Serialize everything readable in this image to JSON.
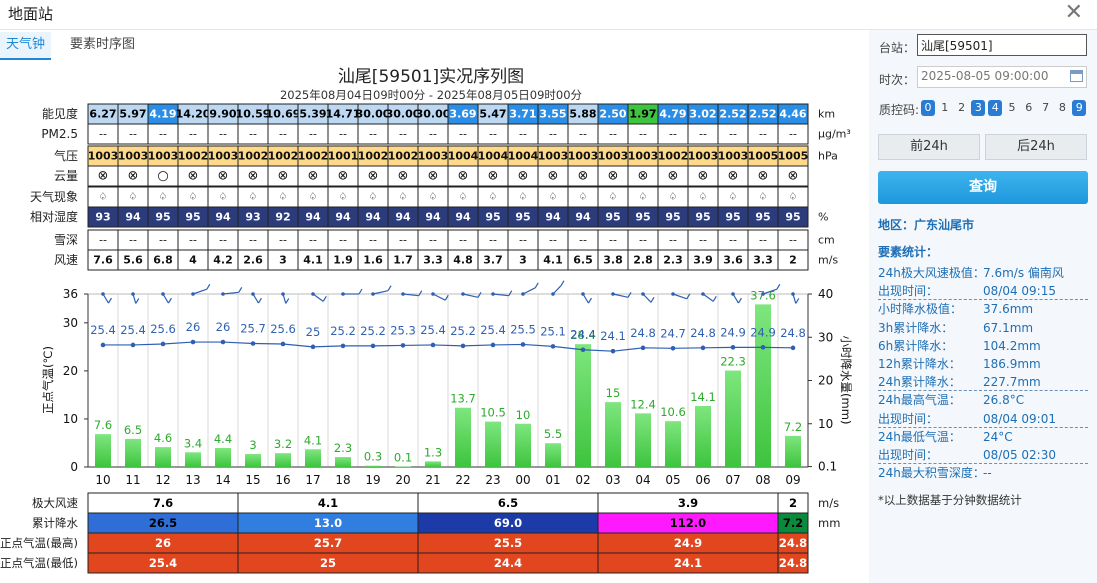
{
  "window": {
    "title": "地面站",
    "close_icon": "close-icon"
  },
  "tabs": [
    {
      "label": "天气钟",
      "active": true
    },
    {
      "label": "要素时序图",
      "active": false
    }
  ],
  "chart_header": {
    "title": "汕尾[59501]实况序列图",
    "subtitle": "2025年08月04日09时00分 - 2025年08月05日09时00分"
  },
  "hours": [
    "10",
    "11",
    "12",
    "13",
    "14",
    "15",
    "16",
    "17",
    "18",
    "19",
    "20",
    "21",
    "22",
    "23",
    "00",
    "01",
    "02",
    "03",
    "04",
    "05",
    "06",
    "07",
    "08",
    "09"
  ],
  "clock_rows": [
    {
      "label": "能见度",
      "unit": "km",
      "kind": "vis",
      "values": [
        "6.27",
        "5.97",
        "4.19",
        "14.20",
        "9.90",
        "10.59",
        "10.69",
        "5.39",
        "14.71",
        "30.00",
        "30.00",
        "30.00",
        "3.69",
        "5.47",
        "3.71",
        "3.55",
        "5.88",
        "2.50",
        "1.97",
        "4.79",
        "3.02",
        "2.52",
        "2.52",
        "4.46"
      ]
    },
    {
      "label": "PM2.5",
      "unit": "μg/m³",
      "kind": "plain",
      "values": [
        "--",
        "--",
        "--",
        "--",
        "--",
        "--",
        "--",
        "--",
        "--",
        "--",
        "--",
        "--",
        "--",
        "--",
        "--",
        "--",
        "--",
        "--",
        "--",
        "--",
        "--",
        "--",
        "--",
        "--"
      ]
    },
    {
      "label": "气压",
      "unit": "hPa",
      "kind": "pres",
      "values": [
        "1003",
        "1003",
        "1003",
        "1002",
        "1003",
        "1002",
        "1002",
        "1002",
        "1001",
        "1002",
        "1002",
        "1003",
        "1004",
        "1004",
        "1004",
        "1003",
        "1003",
        "1003",
        "1003",
        "1002",
        "1003",
        "1003",
        "1005",
        "1005"
      ]
    },
    {
      "label": "云量",
      "unit": "",
      "kind": "cloud",
      "values": [
        "⊗",
        "⊗",
        "○",
        "⊗",
        "⊗",
        "⊗",
        "⊗",
        "⊗",
        "⊗",
        "⊗",
        "⊗",
        "⊗",
        "⊗",
        "⊗",
        "⊗",
        "⊗",
        "⊗",
        "⊗",
        "⊗",
        "⊗",
        "⊗",
        "⊗",
        "⊗",
        "⊗"
      ]
    },
    {
      "label": "天气现象",
      "unit": "",
      "kind": "wx",
      "values": [
        "♤",
        "♤",
        "♤",
        "♤",
        "♤",
        "♤",
        "♤",
        "♤",
        "♤",
        "♤",
        "♤",
        "♤",
        "♤",
        "♤",
        "♤",
        "♤",
        "♤",
        "♤",
        "♤",
        "♤",
        "♤",
        "♤",
        "♤",
        "♤"
      ]
    },
    {
      "label": "相对湿度",
      "unit": "%",
      "kind": "hum",
      "values": [
        "93",
        "94",
        "95",
        "95",
        "94",
        "93",
        "92",
        "94",
        "94",
        "94",
        "94",
        "94",
        "94",
        "95",
        "95",
        "94",
        "94",
        "95",
        "95",
        "95",
        "95",
        "95",
        "95",
        "95"
      ]
    },
    {
      "label": "雪深",
      "unit": "cm",
      "kind": "plain",
      "values": [
        "--",
        "--",
        "--",
        "--",
        "--",
        "--",
        "--",
        "--",
        "--",
        "--",
        "--",
        "--",
        "--",
        "--",
        "--",
        "--",
        "--",
        "--",
        "--",
        "--",
        "--",
        "--",
        "--",
        "--"
      ]
    },
    {
      "label": "风速",
      "unit": "m/s",
      "kind": "plain",
      "values": [
        "7.6",
        "5.6",
        "6.8",
        "4",
        "4.2",
        "2.6",
        "3",
        "4.1",
        "1.9",
        "1.6",
        "1.7",
        "3.3",
        "4.8",
        "3.7",
        "3",
        "4.1",
        "6.5",
        "3.8",
        "2.8",
        "2.3",
        "3.9",
        "3.6",
        "3.3",
        "2"
      ]
    }
  ],
  "chart_data": {
    "type": "bar",
    "categories": [
      "10",
      "11",
      "12",
      "13",
      "14",
      "15",
      "16",
      "17",
      "18",
      "19",
      "20",
      "21",
      "22",
      "23",
      "00",
      "01",
      "02",
      "03",
      "04",
      "05",
      "06",
      "07",
      "08",
      "09"
    ],
    "series": [
      {
        "values": [
          7.6,
          6.5,
          4.6,
          3.4,
          4.4,
          3,
          3.2,
          4.1,
          2.3,
          0.3,
          0.1,
          1.3,
          13.7,
          10.5,
          10,
          5.5,
          28.4,
          15,
          12.4,
          10.6,
          14.1,
          22.3,
          37.6,
          7.2
        ],
        "type": "bar",
        "axis": "right",
        "color": "#3ec43e"
      },
      {
        "values": [
          25.4,
          25.4,
          25.6,
          26,
          26,
          25.7,
          25.6,
          25,
          25.2,
          25.2,
          25.3,
          25.4,
          25.2,
          25.4,
          25.5,
          25.1,
          24.4,
          24.1,
          24.8,
          24.7,
          24.8,
          24.9,
          24.9,
          24.8
        ],
        "type": "line",
        "axis": "left",
        "color": "#2f5fb3"
      }
    ],
    "ylabel": "正点气温(℃)",
    "y2label": "小时降水量(mm)",
    "ylim": [
      0,
      36
    ],
    "y_ticks": [
      "0",
      "10",
      "20",
      "30",
      "36"
    ],
    "y2lim": [
      0.1,
      40
    ],
    "y2_ticks": [
      "0.1",
      "10",
      "20",
      "30",
      "40"
    ],
    "wind_barb_icon": "wind-barb-icon"
  },
  "summary_rows": [
    {
      "label": "极大风速",
      "unit": "m/s",
      "cells": [
        {
          "v": "7.6",
          "span": 5,
          "bg": "#ffffff",
          "fg": "#000"
        },
        {
          "v": "4.1",
          "span": 6,
          "bg": "#ffffff",
          "fg": "#000"
        },
        {
          "v": "6.5",
          "span": 6,
          "bg": "#ffffff",
          "fg": "#000"
        },
        {
          "v": "3.9",
          "span": 6,
          "bg": "#ffffff",
          "fg": "#000"
        },
        {
          "v": "2",
          "span": 1,
          "bg": "#ffffff",
          "fg": "#000"
        }
      ]
    },
    {
      "label": "累计降水",
      "unit": "mm",
      "cells": [
        {
          "v": "26.5",
          "span": 5,
          "bg": "#2e6ed6",
          "fg": "#000"
        },
        {
          "v": "13.0",
          "span": 6,
          "bg": "#2f7ee0",
          "fg": "#fff"
        },
        {
          "v": "69.0",
          "span": 6,
          "bg": "#1c3aa8",
          "fg": "#fff"
        },
        {
          "v": "112.0",
          "span": 6,
          "bg": "#ff19ff",
          "fg": "#000"
        },
        {
          "v": "7.2",
          "span": 1,
          "bg": "#0a8a3c",
          "fg": "#000"
        }
      ]
    },
    {
      "label": "正点气温(最高)",
      "unit": "",
      "cells": [
        {
          "v": "26",
          "span": 5,
          "bg": "#e2461f",
          "fg": "#fff"
        },
        {
          "v": "25.7",
          "span": 6,
          "bg": "#e2461f",
          "fg": "#fff"
        },
        {
          "v": "25.5",
          "span": 6,
          "bg": "#e2461f",
          "fg": "#fff"
        },
        {
          "v": "24.9",
          "span": 6,
          "bg": "#e2461f",
          "fg": "#fff"
        },
        {
          "v": "24.8",
          "span": 1,
          "bg": "#e2461f",
          "fg": "#fff"
        }
      ]
    },
    {
      "label": "正点气温(最低)",
      "unit": "",
      "cells": [
        {
          "v": "25.4",
          "span": 5,
          "bg": "#e2461f",
          "fg": "#fff"
        },
        {
          "v": "25",
          "span": 6,
          "bg": "#e2461f",
          "fg": "#fff"
        },
        {
          "v": "24.4",
          "span": 6,
          "bg": "#e2461f",
          "fg": "#fff"
        },
        {
          "v": "24.1",
          "span": 6,
          "bg": "#e2461f",
          "fg": "#fff"
        },
        {
          "v": "24.8",
          "span": 1,
          "bg": "#e2461f",
          "fg": "#fff"
        }
      ]
    }
  ],
  "colors": {
    "vis_hi": "#bcd8f2",
    "vis_mid": "#2a8ee6",
    "vis_low": "#3ec43e",
    "pres": "#ffd98a",
    "hum": "#2c3b7a",
    "bar": "#3ec43e",
    "line": "#2f5fb3"
  },
  "sidebar": {
    "station_label": "台站：",
    "station_value": "汕尾[59501]",
    "time_label": "时次：",
    "time_value": "2025-08-05 09:00:00",
    "calendar_icon": "calendar-icon",
    "qc_label": "质控码:",
    "qc_codes": [
      {
        "code": "0",
        "on": true
      },
      {
        "code": "1",
        "on": false
      },
      {
        "code": "2",
        "on": false
      },
      {
        "code": "3",
        "on": true
      },
      {
        "code": "4",
        "on": true
      },
      {
        "code": "5",
        "on": false
      },
      {
        "code": "6",
        "on": false
      },
      {
        "code": "7",
        "on": false
      },
      {
        "code": "8",
        "on": false
      },
      {
        "code": "9",
        "on": true
      }
    ],
    "prev_label": "前24h",
    "next_label": "后24h",
    "query_label": "查询",
    "region": "地区：广东汕尾市",
    "stats_title": "要素统计：",
    "stats": [
      {
        "k": "24h极大风速极值：",
        "v": "7.6m/s 偏南风",
        "dash": false
      },
      {
        "k": "出现时间：",
        "v": "08/04 09:15",
        "dash": true
      },
      {
        "k": "小时降水极值：",
        "v": "37.6mm",
        "dash": false
      },
      {
        "k": "3h累计降水：",
        "v": "67.1mm",
        "dash": false
      },
      {
        "k": "6h累计降水：",
        "v": "104.2mm",
        "dash": false
      },
      {
        "k": "12h累计降水：",
        "v": "186.9mm",
        "dash": false
      },
      {
        "k": "24h累计降水：",
        "v": "227.7mm",
        "dash": true
      },
      {
        "k": "24h最高气温：",
        "v": "26.8°C",
        "dash": false
      },
      {
        "k": "出现时间：",
        "v": "08/04 09:01",
        "dash": true
      },
      {
        "k": "24h最低气温：",
        "v": "24°C",
        "dash": false
      },
      {
        "k": "出现时间：",
        "v": "08/05 02:30",
        "dash": true
      },
      {
        "k": "24h最大积雪深度：",
        "v": "--",
        "dash": false
      }
    ],
    "note": "*以上数据基于分钟数据统计"
  }
}
